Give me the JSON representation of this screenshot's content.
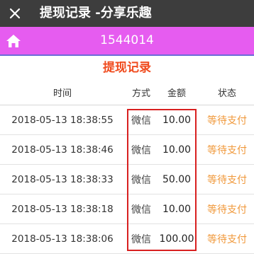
{
  "topbar": {
    "title": "提现记录 -分享乐趣"
  },
  "header": {
    "user_id": "1544014"
  },
  "section": {
    "title": "提现记录"
  },
  "table": {
    "columns": [
      "时间",
      "方式",
      "金额",
      "状态"
    ],
    "rows": [
      {
        "time": "2018-05-13 18:38:55",
        "method": "微信",
        "amount": "10.00",
        "status": "等待支付"
      },
      {
        "time": "2018-05-13 18:38:46",
        "method": "微信",
        "amount": "10.00",
        "status": "等待支付"
      },
      {
        "time": "2018-05-13 18:38:33",
        "method": "微信",
        "amount": "50.00",
        "status": "等待支付"
      },
      {
        "time": "2018-05-13 18:38:18",
        "method": "微信",
        "amount": "10.00",
        "status": "等待支付"
      },
      {
        "time": "2018-05-13 18:38:06",
        "method": "微信",
        "amount": "100.00",
        "status": "等待支付"
      }
    ]
  },
  "colors": {
    "topbar": "#3d3d3d",
    "header": "#e65cf0",
    "title_accent": "#f04b1e",
    "status_pending": "#f0983a",
    "highlight": "#d82020"
  },
  "icons": {
    "close": "close-icon",
    "home": "home-icon"
  }
}
